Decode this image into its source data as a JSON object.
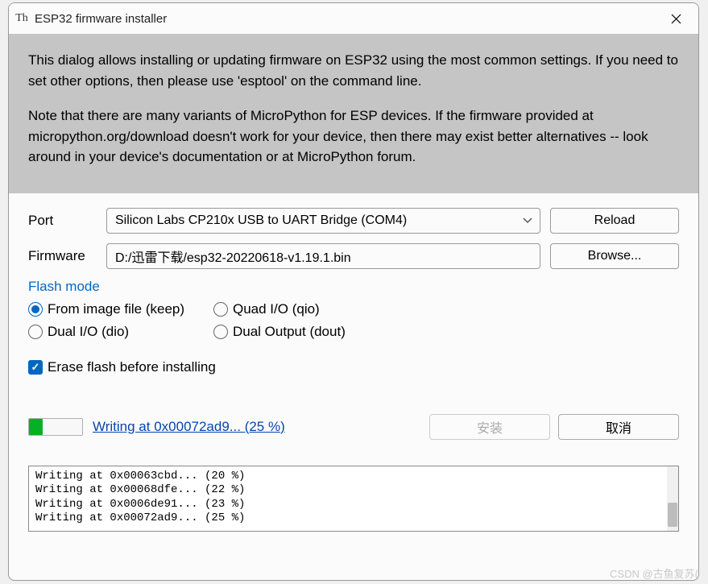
{
  "window": {
    "title": "ESP32 firmware installer"
  },
  "info": {
    "para1": "This dialog allows installing or updating firmware on ESP32 using the most common settings. If you need to set other options, then please use 'esptool' on the command line.",
    "para2": "Note that there are many variants of MicroPython for ESP devices. If the firmware provided at micropython.org/download doesn't work for your device, then there may exist better alternatives -- look around in your device's documentation or at MicroPython forum."
  },
  "form": {
    "port_label": "Port",
    "port_value": "Silicon Labs CP210x USB to UART Bridge (COM4)",
    "reload_label": "Reload",
    "firmware_label": "Firmware",
    "firmware_value": "D:/迅雷下载/esp32-20220618-v1.19.1.bin",
    "browse_label": "Browse..."
  },
  "flash": {
    "legend": "Flash mode",
    "options": {
      "keep": "From image file (keep)",
      "qio": "Quad I/O (qio)",
      "dio": "Dual I/O (dio)",
      "dout": "Dual Output (dout)"
    },
    "selected": "keep"
  },
  "erase": {
    "label": "Erase flash before installing",
    "checked": true
  },
  "progress": {
    "percent": 25,
    "status_text": "Writing at 0x00072ad9... (25 %)"
  },
  "buttons": {
    "install": "安装",
    "cancel": "取消"
  },
  "log": {
    "lines": [
      "Writing at 0x00063cbd... (20 %)",
      "Writing at 0x00068dfe... (22 %)",
      "Writing at 0x0006de91... (23 %)",
      "Writing at 0x00072ad9... (25 %)"
    ]
  },
  "watermark": "CSDN @古鱼复苏("
}
